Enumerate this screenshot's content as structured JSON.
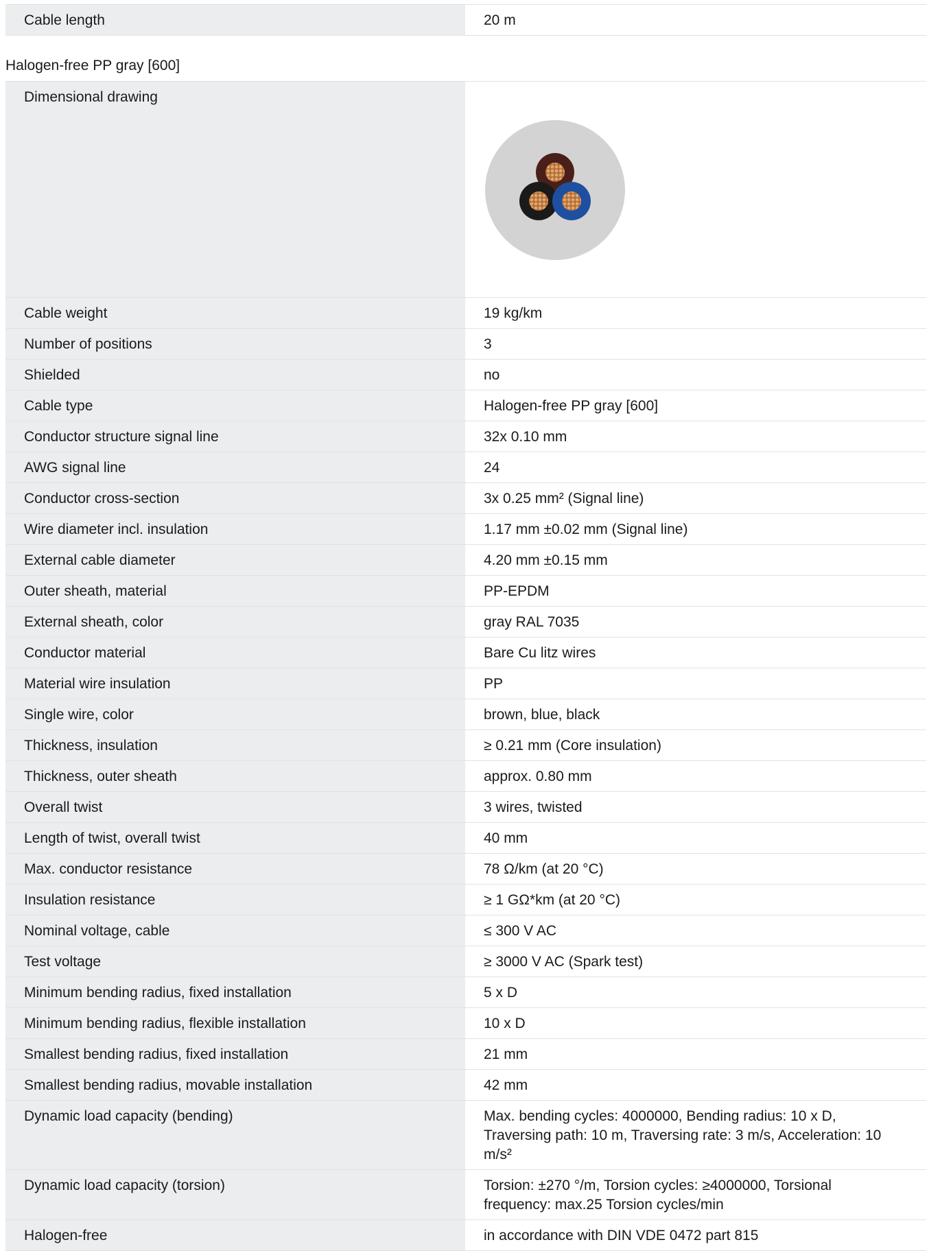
{
  "top_rows": [
    {
      "label": "Cable length",
      "value": "20 m"
    }
  ],
  "section": {
    "title": "Halogen-free PP gray [600]",
    "drawing_label": "Dimensional drawing",
    "drawing": {
      "sheath_color": "#d3d3d3",
      "wires": [
        {
          "color": "brown",
          "hex": "#4a1f1a"
        },
        {
          "color": "blue",
          "hex": "#1f4fa0"
        },
        {
          "color": "black",
          "hex": "#1a1a1a"
        }
      ],
      "core_color": "#c88a55"
    }
  },
  "rows": [
    {
      "label": "Cable weight",
      "value": "19 kg/km"
    },
    {
      "label": "Number of positions",
      "value": "3"
    },
    {
      "label": "Shielded",
      "value": "no"
    },
    {
      "label": "Cable type",
      "value": "Halogen-free PP gray [600]"
    },
    {
      "label": "Conductor structure signal line",
      "value": "32x 0.10 mm"
    },
    {
      "label": "AWG signal line",
      "value": "24"
    },
    {
      "label": "Conductor cross-section",
      "value": "3x 0.25 mm² (Signal line)"
    },
    {
      "label": "Wire diameter incl. insulation",
      "value": "1.17 mm ±0.02 mm (Signal line)"
    },
    {
      "label": "External cable diameter",
      "value": "4.20 mm ±0.15 mm"
    },
    {
      "label": "Outer sheath, material",
      "value": "PP-EPDM"
    },
    {
      "label": "External sheath, color",
      "value": "gray RAL 7035"
    },
    {
      "label": "Conductor material",
      "value": "Bare Cu litz wires"
    },
    {
      "label": "Material wire insulation",
      "value": "PP"
    },
    {
      "label": "Single wire, color",
      "value": "brown, blue, black"
    },
    {
      "label": "Thickness, insulation",
      "value": "≥ 0.21 mm (Core insulation)"
    },
    {
      "label": "Thickness, outer sheath",
      "value": "approx. 0.80 mm"
    },
    {
      "label": "Overall twist",
      "value": "3 wires, twisted"
    },
    {
      "label": "Length of twist, overall twist",
      "value": "40 mm"
    },
    {
      "label": "Max. conductor resistance",
      "value": "78 Ω/km (at 20 °C)"
    },
    {
      "label": "Insulation resistance",
      "value": "≥ 1 GΩ*km (at 20 °C)"
    },
    {
      "label": "Nominal voltage, cable",
      "value": "≤ 300 V AC"
    },
    {
      "label": "Test voltage",
      "value": "≥ 3000 V AC (Spark test)"
    },
    {
      "label": "Minimum bending radius, fixed installation",
      "value": "5 x D"
    },
    {
      "label": "Minimum bending radius, flexible installation",
      "value": "10 x D"
    },
    {
      "label": "Smallest bending radius, fixed installation",
      "value": "21 mm"
    },
    {
      "label": "Smallest bending radius, movable installation",
      "value": "42 mm"
    },
    {
      "label": "Dynamic load capacity (bending)",
      "value": "Max. bending cycles: 4000000, Bending radius: 10 x D, Traversing path: 10 m, Traversing rate: 3 m/s, Acceleration: 10 m/s²"
    },
    {
      "label": "Dynamic load capacity (torsion)",
      "value": "Torsion: ±270 °/m, Torsion cycles: ≥4000000, Torsional frequency: max.25 Torsion cycles/min"
    },
    {
      "label": "Halogen-free",
      "value": "in accordance with DIN VDE 0472 part 815"
    }
  ]
}
